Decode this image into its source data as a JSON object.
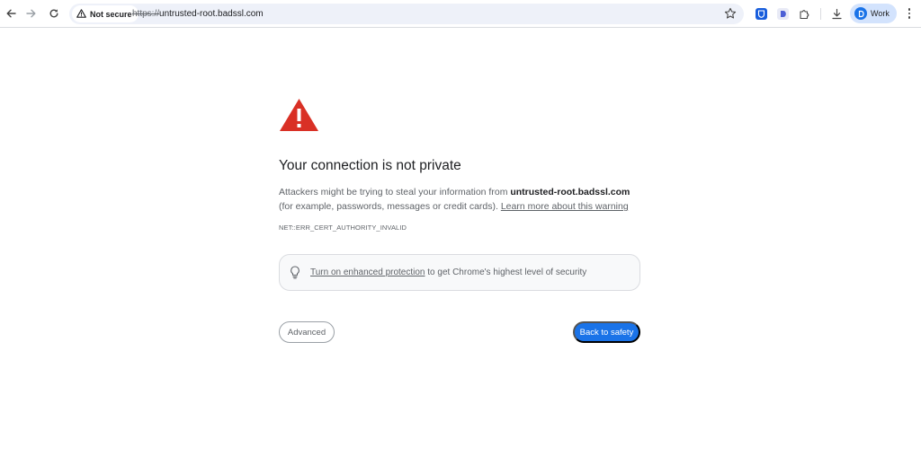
{
  "toolbar": {
    "security_chip": "Not secure",
    "url_scheme": "https://",
    "url_host": "untrusted-root.badssl.com",
    "profile_label": "Work",
    "profile_initial": "D",
    "extensions": [
      "bitwarden-icon",
      "dashlane-icon",
      "extensions-puzzle-icon"
    ]
  },
  "interstitial": {
    "heading": "Your connection is not private",
    "explanation_prefix": "Attackers might be trying to steal your information from ",
    "explanation_host": "untrusted-root.badssl.com",
    "explanation_suffix": " (for example, passwords, messages or credit cards). ",
    "learn_more": "Learn more about this warning",
    "error_code": "NET::ERR_CERT_AUTHORITY_INVALID",
    "enhanced_link": "Turn on enhanced protection",
    "enhanced_suffix": " to get Chrome's highest level of security",
    "advanced_button": "Advanced",
    "back_button": "Back to safety"
  },
  "colors": {
    "warning_red": "#d93025",
    "primary_blue": "#1a73e8",
    "omnibox_bg": "#eef1f9",
    "profile_bg": "#d3e3fd"
  }
}
